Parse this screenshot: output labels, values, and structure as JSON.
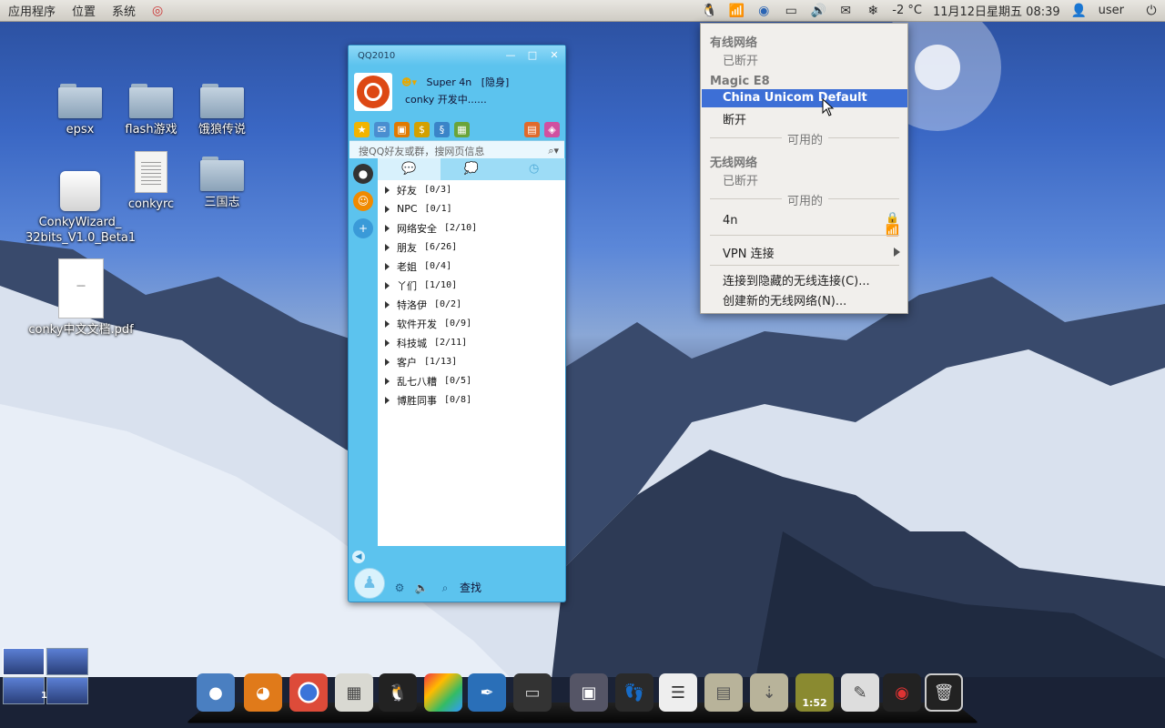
{
  "top_panel": {
    "menus": [
      "应用程序",
      "位置",
      "系统"
    ],
    "tray_icons": [
      "qq-tray-icon",
      "network-wireless-icon",
      "globe-icon",
      "computer-network-icon",
      "volume-icon",
      "mail-icon"
    ],
    "weather": "-2 °C",
    "datetime": "11月12日星期五 08:39",
    "user": "user"
  },
  "desktop": {
    "icons": [
      {
        "label": "epsx",
        "type": "folder"
      },
      {
        "label": "flash游戏",
        "type": "folder"
      },
      {
        "label": "饿狼传说",
        "type": "folder"
      },
      {
        "label": "ConkyWizard_\n32bits_V1.0_Beta1",
        "type": "package"
      },
      {
        "label": "conkyrc",
        "type": "text-file"
      },
      {
        "label": "三国志",
        "type": "folder"
      },
      {
        "label": "conky中文文档.pdf",
        "type": "pdf"
      }
    ]
  },
  "qq": {
    "title": "QQ2010",
    "nickname": "Super 4n",
    "status": "[隐身]",
    "signature": "conky 开发中......",
    "search_placeholder": "搜QQ好友或群，搜网页信息",
    "groups": [
      {
        "name": "好友",
        "count": "[0/3]"
      },
      {
        "name": "NPC",
        "count": "[0/1]"
      },
      {
        "name": "网络安全",
        "count": "[2/10]"
      },
      {
        "name": "朋友",
        "count": "[6/26]"
      },
      {
        "name": "老姐",
        "count": "[0/4]"
      },
      {
        "name": "丫们",
        "count": "[1/10]"
      },
      {
        "name": "特洛伊",
        "count": "[0/2]"
      },
      {
        "name": "软件开发",
        "count": "[0/9]"
      },
      {
        "name": "科技城",
        "count": "[2/11]"
      },
      {
        "name": "客户",
        "count": "[1/13]"
      },
      {
        "name": "乱七八糟",
        "count": "[0/5]"
      },
      {
        "name": "博胜同事",
        "count": "[0/8]"
      }
    ],
    "find_label": "查找"
  },
  "network_menu": {
    "wired_header": "有线网络",
    "wired_status": "已断开",
    "device_header": "Magic E8",
    "selected_item": "China Unicom Default",
    "disconnect": "断开",
    "available_1": "可用的",
    "wireless_header": "无线网络",
    "wireless_status": "已断开",
    "available_2": "可用的",
    "wifi_network": "4n",
    "vpn": "VPN 连接",
    "connect_hidden": "连接到隐藏的无线连接(C)...",
    "create_new": "创建新的无线网络(N)..."
  },
  "dock": {
    "clock": "1:52",
    "workspace_number": "1"
  }
}
